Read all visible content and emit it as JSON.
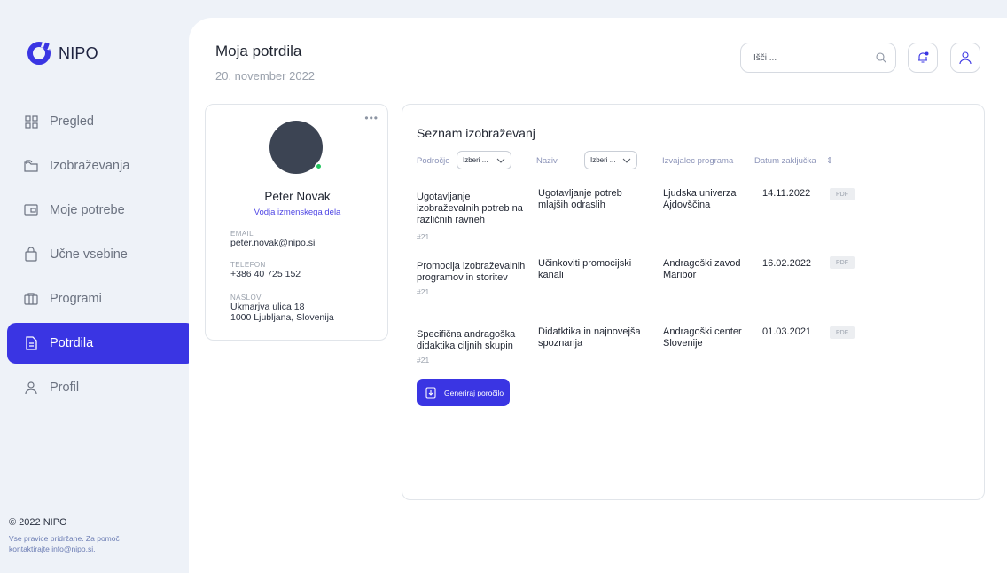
{
  "brand": {
    "name": "NIPO",
    "color": "#3a35e3"
  },
  "sidebar": {
    "items": [
      {
        "label": "Pregled",
        "icon": "grid-icon"
      },
      {
        "label": "Izobraževanja",
        "icon": "folder-icon"
      },
      {
        "label": "Moje potrebe",
        "icon": "screen-icon"
      },
      {
        "label": "Učne vsebine",
        "icon": "bag-icon"
      },
      {
        "label": "Programi",
        "icon": "programs-icon"
      },
      {
        "label": "Potrdila",
        "icon": "document-icon",
        "active": true
      },
      {
        "label": "Profil",
        "icon": "user-icon"
      }
    ]
  },
  "footer": {
    "copyright": "© 2022 NIPO",
    "line1": "Vse pravice pridržane. Za pomoč",
    "line2": "kontaktirajte info@nipo.si."
  },
  "header": {
    "title": "Moja potrdila",
    "date": "20. november 2022",
    "search_placeholder": "Išči ..."
  },
  "profile": {
    "name": "Peter Novak",
    "role": "Vodja izmenskega dela",
    "email_label": "EMAIL",
    "email": "peter.novak@nipo.si",
    "phone_label": "TELEFON",
    "phone": "+386 40 725 152",
    "address_label": "NASLOV",
    "address_line1": "Ukmarjva ulica 18",
    "address_line2": "1000 Ljubljana, Slovenija",
    "menu": "•••"
  },
  "trainings": {
    "title": "Seznam izobraževanj",
    "filters": {
      "area_label": "Področje",
      "area_value": "Izberi ...",
      "name_label": "Naziv",
      "name_value": "Izberi ...",
      "provider_label": "Izvajalec programa",
      "date_label": "Datum zaključka",
      "sort_icon": "⇕"
    },
    "rows": [
      {
        "area": [
          "Ugotavljanje",
          "izobraževalnih potreb na",
          "različnih ravneh"
        ],
        "number": "#21",
        "name": [
          "Ugotavljanje potreb",
          "mlajših odraslih"
        ],
        "provider": [
          "Ljudska univerza",
          "Ajdovščina"
        ],
        "date": "14.11.2022",
        "file": "PDF"
      },
      {
        "area": [
          "Promocija izobraževalnih",
          "programov in storitev"
        ],
        "number": "#21",
        "name": [
          "Učinkoviti promocijski",
          "kanali"
        ],
        "provider": [
          "Andragoški zavod",
          "Maribor"
        ],
        "date": "16.02.2022",
        "file": "PDF"
      },
      {
        "area": [
          "Specifična andragoška",
          "didaktika ciljnih skupin"
        ],
        "number": "#21",
        "name": [
          "Didatktika in najnovejša",
          "spoznanja"
        ],
        "provider": [
          "Andragoški center",
          "Slovenije"
        ],
        "date": "01.03.2021",
        "file": "PDF"
      }
    ],
    "generate_label": "Generiraj poročilo"
  }
}
